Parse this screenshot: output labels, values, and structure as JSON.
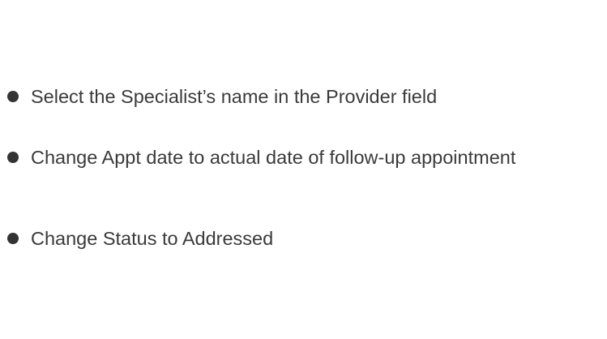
{
  "slide": {
    "bullets": [
      {
        "text": "Select the Specialist’s name in the Provider field"
      },
      {
        "text": "Change Appt date to actual date of follow-up appointment"
      },
      {
        "text": "Change Status to Addressed"
      }
    ]
  },
  "colors": {
    "text": "#3a3a3a",
    "bullet": "#333333",
    "background": "#ffffff"
  },
  "icons": {
    "bullet": "filled-circle"
  }
}
